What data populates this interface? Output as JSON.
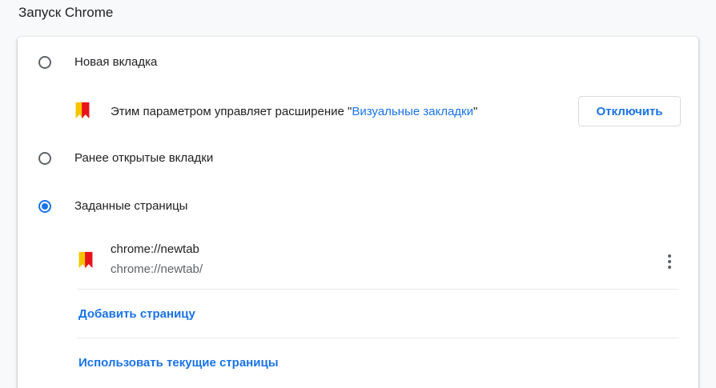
{
  "section": {
    "title": "Запуск Chrome"
  },
  "options": [
    {
      "label": "Новая вкладка",
      "checked": false
    },
    {
      "label": "Ранее открытые вкладки",
      "checked": false
    },
    {
      "label": "Заданные страницы",
      "checked": true
    }
  ],
  "managed": {
    "text_before": "Этим параметром управляет расширение ",
    "quote_open": "\"",
    "extension_name": "Визуальные закладки",
    "quote_close": "\"",
    "disable_button": "Отключить",
    "icon": "bookmark-extension-icon"
  },
  "startup_pages": [
    {
      "title": "chrome://newtab",
      "url": "chrome://newtab/",
      "icon": "bookmark-extension-icon",
      "menu_icon": "more-vert-icon"
    }
  ],
  "actions": {
    "add_page": "Добавить страницу",
    "use_current": "Использовать текущие страницы"
  },
  "colors": {
    "accent": "#1a73e8",
    "icon_yellow": "#f5c400",
    "icon_red": "#e8141c"
  }
}
